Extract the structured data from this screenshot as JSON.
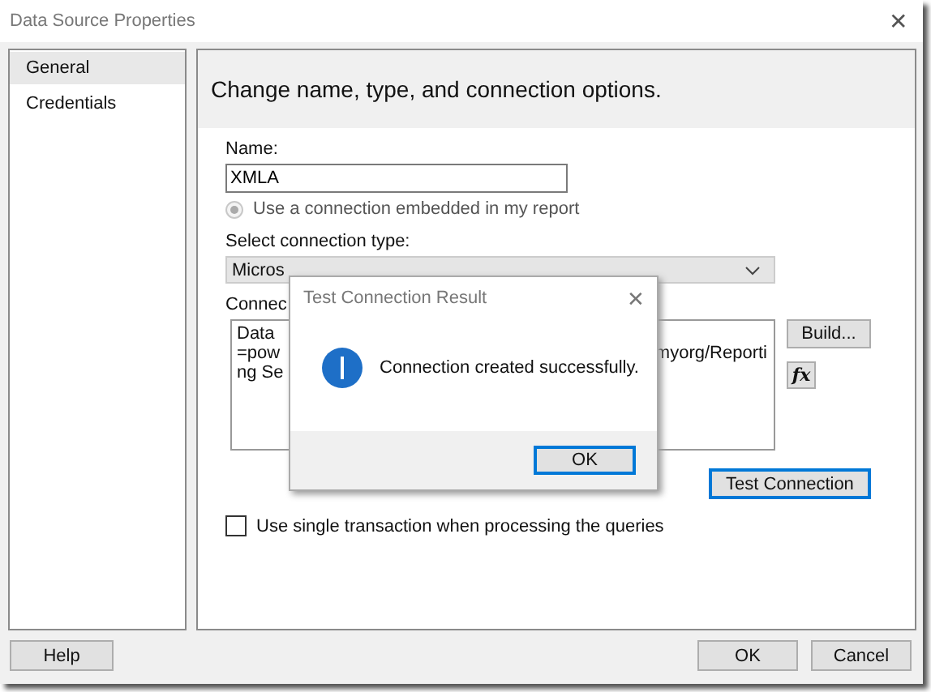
{
  "window": {
    "title": "Data Source Properties",
    "close": "✕"
  },
  "sidebar": {
    "items": [
      {
        "label": "General",
        "selected": true
      },
      {
        "label": "Credentials",
        "selected": false
      }
    ]
  },
  "header": "Change name, type, and connection options.",
  "name_field": {
    "label": "Name:",
    "value": "XMLA"
  },
  "embedded_option": {
    "label": "Use a connection embedded in my report",
    "selected": true,
    "disabled": true
  },
  "connection_type": {
    "label": "Select connection type:",
    "value": "Micros"
  },
  "connection_string": {
    "label": "Connec",
    "lines_left": [
      "Data",
      "=pow",
      "ng Se"
    ],
    "line_right": "myorg/Reporti"
  },
  "build_button": "Build...",
  "expression_button": "fx",
  "test_button": "Test Connection",
  "single_transaction": {
    "label": "Use single transaction when processing the queries",
    "checked": false
  },
  "footer_buttons": [
    {
      "label": "Help"
    },
    {
      "label": "OK"
    },
    {
      "label": "Cancel"
    }
  ],
  "message_box": {
    "title": "Test Connection Result",
    "close": "✕",
    "message": "Connection created successfully.",
    "button": "OK"
  }
}
